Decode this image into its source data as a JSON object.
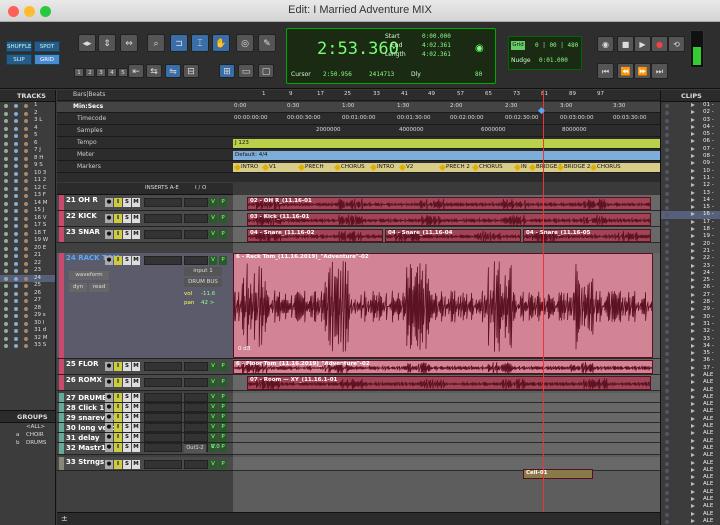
{
  "window": {
    "title": "Edit: I Married Adventure MIX"
  },
  "toolbar": {
    "modes": [
      "SHUFFLE",
      "SPOT",
      "SLIP",
      "GRID"
    ],
    "zoom_presets": [
      "1",
      "2",
      "3",
      "4",
      "5"
    ],
    "counter": {
      "main": "2:53.360",
      "start_label": "Start",
      "start": "0:00.000",
      "end_label": "End",
      "end": "4:02.361",
      "length_label": "Length",
      "length": "4:02.361",
      "cursor_label": "Cursor",
      "cursor": "2:50.956",
      "sample": "2414713",
      "dly_label": "Dly",
      "tempo": "80"
    },
    "grid": {
      "label": "Grid",
      "value": "0 | 00 | 480"
    },
    "nudge": {
      "label": "Nudge",
      "value": "0:01.000"
    }
  },
  "tracks_panel": {
    "title": "TRACKS",
    "items": [
      "1",
      "2",
      "3 L",
      "4",
      "5",
      "6",
      "7 J",
      "8 H",
      "9 S",
      "10 3",
      "11 2",
      "12 C",
      "13 F",
      "14 M",
      "15 J",
      "16 V",
      "17 S",
      "18 T",
      "19 W",
      "20 E",
      "21",
      "22",
      "23",
      "24",
      "25",
      "26",
      "27",
      "28",
      "29 s",
      "30 l",
      "31 d",
      "32 M",
      "33 S"
    ]
  },
  "groups_panel": {
    "title": "GROUPS",
    "items": [
      {
        "letter": "",
        "name": "<ALL>"
      },
      {
        "letter": "a",
        "name": "CHOIR"
      },
      {
        "letter": "b",
        "name": "DRUMS"
      }
    ]
  },
  "clips_panel": {
    "title": "CLIPS",
    "items": [
      "01 -",
      "02 -",
      "03 -",
      "04 -",
      "05 -",
      "06 -",
      "07 -",
      "08 -",
      "09 -",
      "10 -",
      "11 -",
      "12 -",
      "13 -",
      "14 -",
      "15 -",
      "16 -",
      "17 -",
      "18 -",
      "19 -",
      "20 -",
      "21 -",
      "22 -",
      "23 -",
      "24 -",
      "25 -",
      "26 -",
      "27 -",
      "28 -",
      "29 -",
      "30 -",
      "31 -",
      "32 -",
      "33 -",
      "34 -",
      "35 -",
      "36 -",
      "37 -",
      "ALE",
      "ALE",
      "ALE",
      "ALE",
      "ALE",
      "ALE",
      "ALE",
      "ALE",
      "ALE",
      "ALE",
      "ALE",
      "ALE",
      "ALE",
      "ALE",
      "ALE",
      "ALE",
      "ALE",
      "ALE",
      "ALE",
      "ALE",
      "ALE",
      "ALE"
    ]
  },
  "rulers": {
    "bars_label": "Bars|Beats",
    "bars": [
      "1",
      "9",
      "17",
      "25",
      "33",
      "41",
      "49",
      "57",
      "65",
      "73",
      "81",
      "89",
      "97"
    ],
    "minsec_label": "Min:Secs",
    "minsec": [
      "0:00",
      "0:30",
      "1:00",
      "1:30",
      "2:00",
      "2:30",
      "3:00",
      "3:30"
    ],
    "timecode_label": "Timecode",
    "timecode": [
      "00:00:00:00",
      "00:00:30:00",
      "00:01:00:00",
      "00:01:30:00",
      "00:02:00:00",
      "00:02:30:00",
      "00:03:00:00",
      "00:03:30:00"
    ],
    "samples_label": "Samples",
    "samples": [
      "2000000",
      "4000000",
      "6000000",
      "8000000"
    ],
    "tempo_label": "Tempo",
    "tempo_value": "J 123",
    "meter_label": "Meter",
    "meter_value": "Default: 4/4",
    "markers_label": "Markers",
    "markers": [
      "INTRO",
      "V1",
      "PRECH",
      "CHORUS",
      "INTRO",
      "V2",
      "PRECH 2",
      "CHORUS",
      "IN",
      "BRIDGE 1",
      "BRIDGE 2",
      "CHORUS"
    ]
  },
  "mix_header": {
    "inserts": "INSERTS A-E",
    "io": "I / O"
  },
  "tracks": [
    {
      "num": "21",
      "name": "OH R"
    },
    {
      "num": "22",
      "name": "KICK"
    },
    {
      "num": "23",
      "name": "SNAR"
    },
    {
      "num": "24",
      "name": "RACK TOM",
      "input": "input 1",
      "output": "DRUM BUS",
      "view": "waveform",
      "dyn": "dyn",
      "auto": "read",
      "vol_label": "vol",
      "vol": "-11.6",
      "pan_label": "pan",
      "pan": "42 >"
    },
    {
      "num": "25",
      "name": "FLOR"
    },
    {
      "num": "26",
      "name": "ROMX"
    },
    {
      "num": "27",
      "name": "DRUMBU"
    },
    {
      "num": "28",
      "name": "Click 1"
    },
    {
      "num": "29",
      "name": "snareverb"
    },
    {
      "num": "30",
      "name": "long verb"
    },
    {
      "num": "31",
      "name": "delay"
    },
    {
      "num": "32",
      "name": "Mastr1",
      "out": "Out1-2",
      "vol": "0.0"
    },
    {
      "num": "33",
      "name": "Strngs"
    }
  ],
  "clips": {
    "oh_r": "02 - OH R_(11.16-01",
    "kick": "03 - Kick_(11.16-01",
    "snare_1": "04 - Snare_(11.16-02",
    "snare_2": "04 - Snare_(11.16-04",
    "snare_3": "04 - Snare_(11.16-05",
    "rack": "6 - Rack Tom_(11.16.2019)_\"Adventure\"-02",
    "rack_db": "0 dB",
    "floor": "6 - Floor Tom_(11.16.2019)_\"Adventure\"-02",
    "room": "07 - Room — XY_(11.16.1-01",
    "cello": "Cell-01"
  },
  "colors": {
    "clip": "#a14456",
    "counter": "#1b2a12",
    "accent_blue": "#3a6ea8"
  }
}
